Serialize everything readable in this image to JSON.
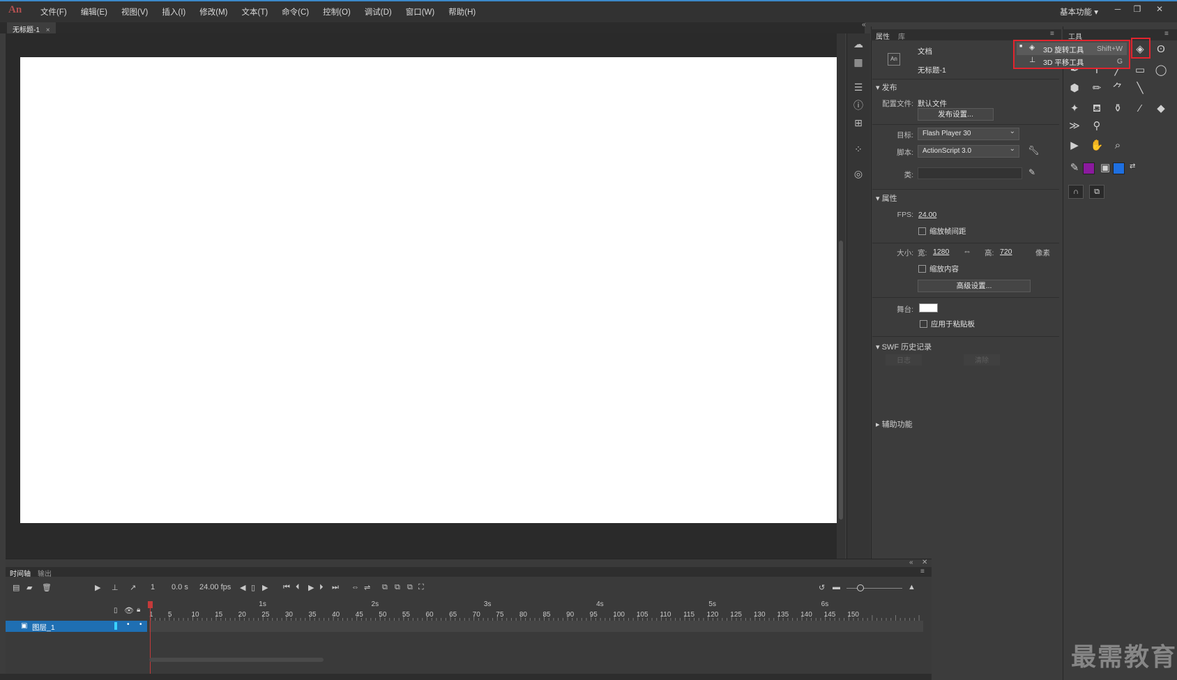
{
  "app": {
    "logo": "An"
  },
  "menu": [
    "文件(F)",
    "编辑(E)",
    "视图(V)",
    "插入(I)",
    "修改(M)",
    "文本(T)",
    "命令(C)",
    "控制(O)",
    "调试(D)",
    "窗口(W)",
    "帮助(H)"
  ],
  "workspace": {
    "label": "基本功能",
    "arrow": "▾"
  },
  "window_buttons": [
    "─",
    "❐",
    "✕"
  ],
  "document_tab": {
    "title": "无标题-1",
    "close": "×"
  },
  "properties_panel": {
    "tabs": [
      "属性",
      "库"
    ],
    "doc_type": "文档",
    "doc_name": "无标题-1",
    "doc_icon": "An",
    "publish": {
      "header": "发布",
      "profile_label": "配置文件:",
      "profile_value": "默认文件",
      "settings_button": "发布设置...",
      "target_label": "目标:",
      "target_value": "Flash Player 30",
      "script_label": "脚本:",
      "script_value": "ActionScript 3.0",
      "class_label": "类:"
    },
    "properties": {
      "header": "属性",
      "fps_label": "FPS:",
      "fps_value": "24.00",
      "scale_spans_label": "缩放帧间距",
      "size_label": "大小:",
      "width_label": "宽:",
      "width_value": "1280",
      "height_label": "高:",
      "height_value": "720",
      "unit": "像素",
      "scale_content_label": "缩放内容",
      "advanced_button": "高级设置...",
      "stage_label": "舞台:",
      "stage_color": "#ffffff",
      "pasteboard_label": "应用于粘贴板"
    },
    "swf_history": {
      "header": "SWF 历史记录",
      "log_button": "日志",
      "clear_button": "清除"
    },
    "accessibility": {
      "header": "辅助功能"
    }
  },
  "tools_panel": {
    "tab": "工具",
    "flyout": [
      {
        "label": "3D 旋转工具",
        "shortcut": "Shift+W",
        "selected": true
      },
      {
        "label": "3D 平移工具",
        "shortcut": "G",
        "selected": false
      }
    ],
    "stroke_color": "#8b1a9e",
    "fill_color": "#1e6fe0"
  },
  "timeline": {
    "tabs": [
      "时间轴",
      "输出"
    ],
    "current_frame": "1",
    "time": "0.0 s",
    "fps": "24.00 fps",
    "seconds": [
      "1s",
      "2s",
      "3s",
      "4s",
      "5s",
      "6s"
    ],
    "frame_numbers": [
      "1",
      "5",
      "10",
      "15",
      "20",
      "25",
      "30",
      "35",
      "40",
      "45",
      "50",
      "55",
      "60",
      "65",
      "70",
      "75",
      "80",
      "85",
      "90",
      "95",
      "100",
      "105",
      "110",
      "115",
      "120",
      "125",
      "130",
      "135",
      "140",
      "145",
      "150"
    ],
    "layers": [
      {
        "name": "图层_1"
      }
    ]
  },
  "watermark": "最需教育"
}
